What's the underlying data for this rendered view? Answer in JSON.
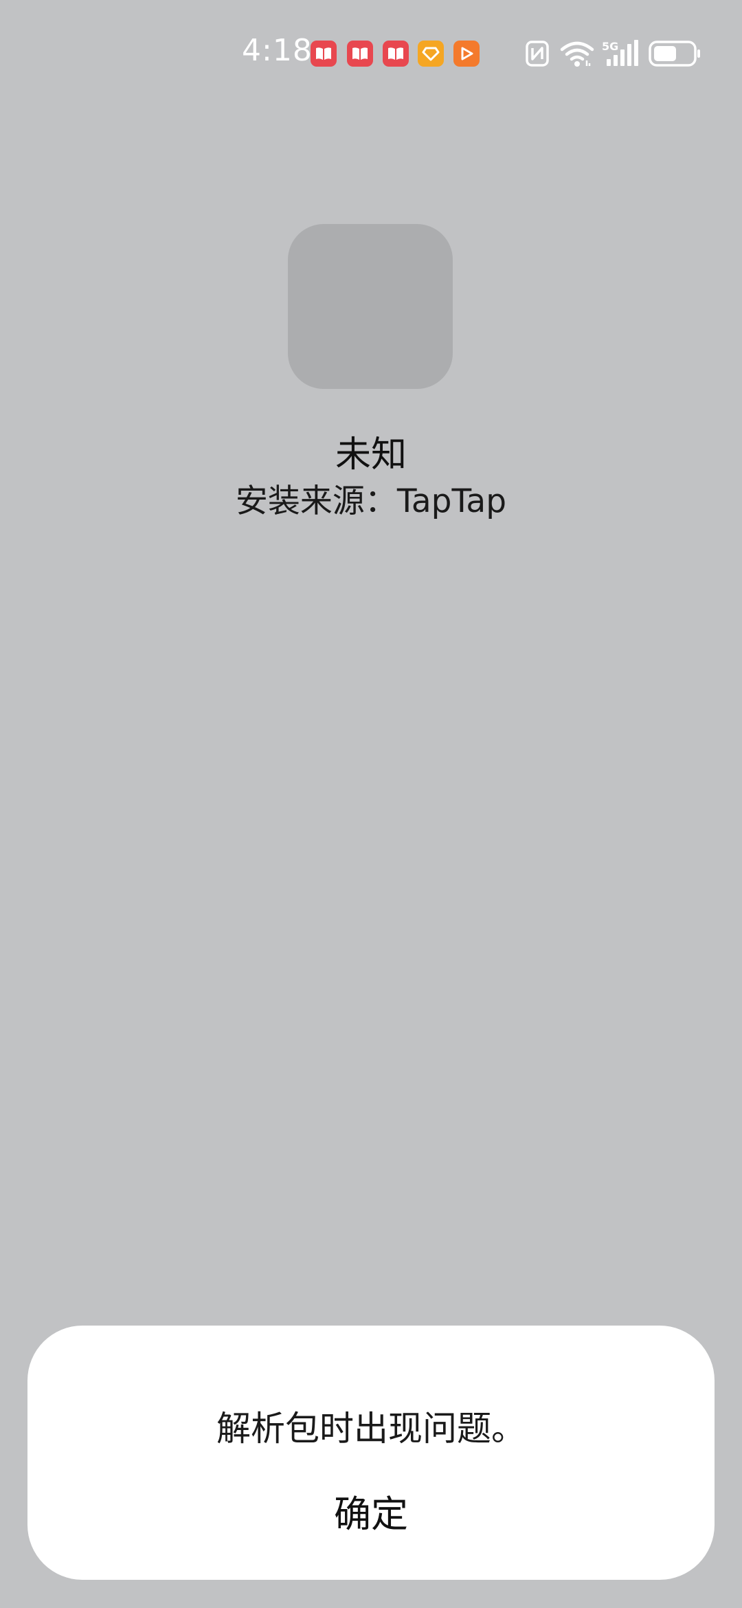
{
  "status_bar": {
    "time": "4:18",
    "notification_icons": [
      "book-icon",
      "book-icon",
      "book-icon",
      "diamond-icon",
      "play-icon"
    ],
    "system_icons": [
      "nfc-icon",
      "wifi-icon",
      "signal-5g-icon",
      "battery-icon"
    ],
    "network_label": "5G",
    "colors": {
      "book": "#e8474f",
      "diamond": "#f5a623",
      "play": "#f47a2c"
    }
  },
  "app": {
    "name": "未知",
    "install_source": "安装来源：TapTap"
  },
  "dialog": {
    "message": "解析包时出现问题。",
    "confirm_label": "确定"
  },
  "colors": {
    "background": "#c1c2c4",
    "placeholder_icon": "#acadaf",
    "dialog_background": "#ffffff"
  }
}
